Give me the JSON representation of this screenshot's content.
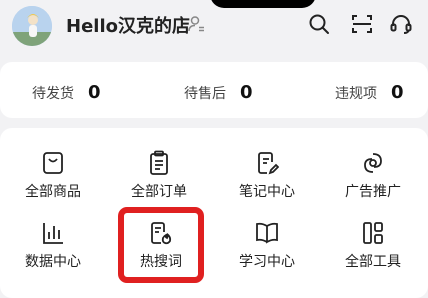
{
  "header": {
    "shop_name": "Hello汉克的店",
    "buttons": [
      {
        "icon": "search-icon"
      },
      {
        "icon": "scan-icon"
      },
      {
        "icon": "customer-service-icon"
      }
    ]
  },
  "stats": [
    {
      "label": "待发货",
      "value": "0"
    },
    {
      "label": "待售后",
      "value": "0"
    },
    {
      "label": "违规项",
      "value": "0"
    }
  ],
  "tools": [
    {
      "label": "全部商品",
      "icon": "shopping-bag-icon"
    },
    {
      "label": "全部订单",
      "icon": "clipboard-icon"
    },
    {
      "label": "笔记中心",
      "icon": "note-pen-icon"
    },
    {
      "label": "广告推广",
      "icon": "promotion-icon"
    },
    {
      "label": "数据中心",
      "icon": "bar-chart-icon"
    },
    {
      "label": "热搜词",
      "icon": "hot-search-icon"
    },
    {
      "label": "学习中心",
      "icon": "open-book-icon"
    },
    {
      "label": "全部工具",
      "icon": "grid-tools-icon"
    }
  ],
  "colors": {
    "highlight": "#e02020",
    "background": "#f2f2f4",
    "card": "#ffffff"
  }
}
